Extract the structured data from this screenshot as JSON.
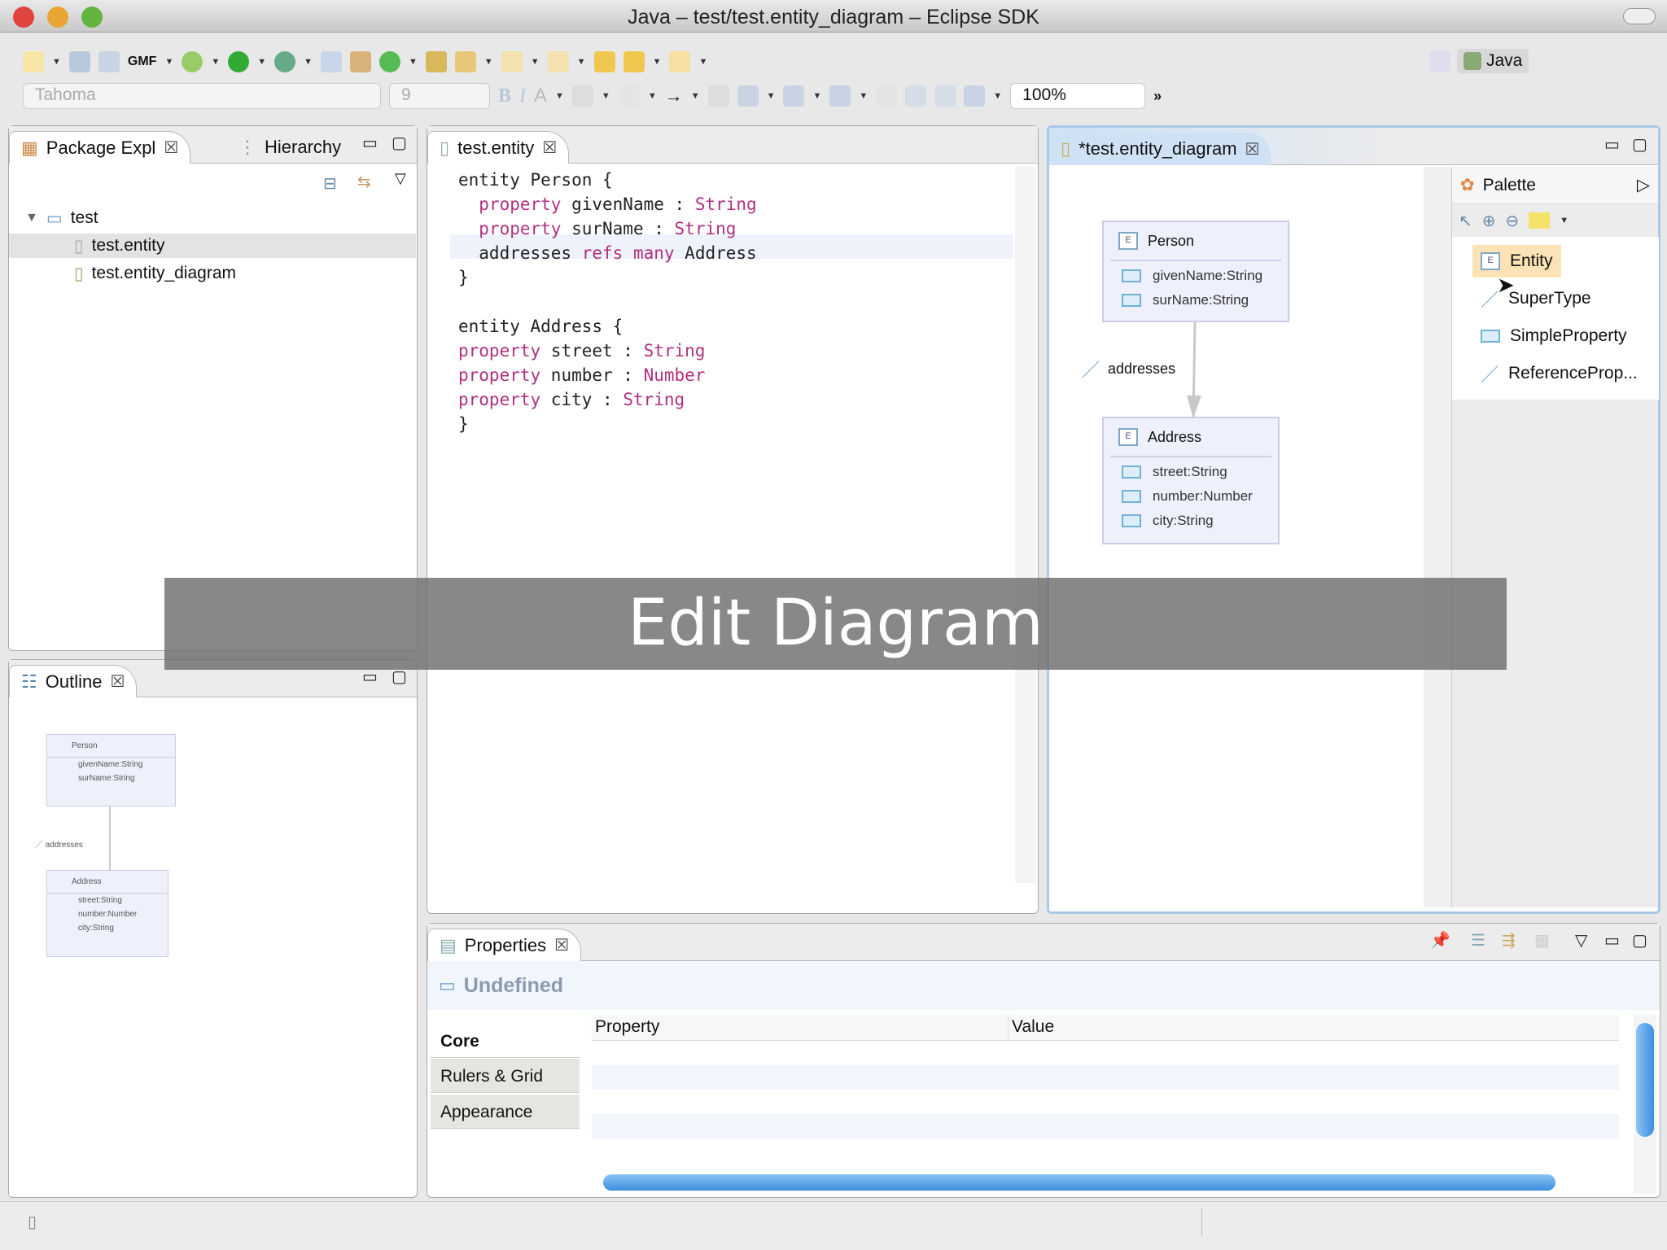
{
  "window": {
    "title": "Java – test/test.entity_diagram – Eclipse SDK"
  },
  "toolbar": {
    "gmf_label": "GMF",
    "font_name": "Tahoma",
    "font_size": "9",
    "zoom": "100%",
    "more": "»",
    "perspective": "Java"
  },
  "package_explorer": {
    "tab_label": "Package Expl",
    "hierarchy_tab": "Hierarchy",
    "tree": [
      {
        "label": "test"
      },
      {
        "label": "test.entity"
      },
      {
        "label": "test.entity_diagram"
      }
    ]
  },
  "outline": {
    "tab_label": "Outline"
  },
  "text_editor": {
    "tab_label": "test.entity",
    "lines": [
      [
        {
          "t": "entity Person {"
        }
      ],
      [
        {
          "t": "  "
        },
        {
          "t": "property",
          "k": 1
        },
        {
          "t": " givenName : "
        },
        {
          "t": "String",
          "k": 1
        }
      ],
      [
        {
          "t": "  "
        },
        {
          "t": "property",
          "k": 1
        },
        {
          "t": " surName : "
        },
        {
          "t": "String",
          "k": 1
        }
      ],
      [
        {
          "t": "  addresses "
        },
        {
          "t": "refs",
          "k": 1
        },
        {
          "t": " "
        },
        {
          "t": "many",
          "k": 1
        },
        {
          "t": " Address"
        }
      ],
      [
        {
          "t": "}"
        }
      ],
      [
        {
          "t": ""
        }
      ],
      [
        {
          "t": "entity Address {"
        }
      ],
      [
        {
          "t": "property",
          "k": 1
        },
        {
          "t": " street : "
        },
        {
          "t": "String",
          "k": 1
        }
      ],
      [
        {
          "t": "property",
          "k": 1
        },
        {
          "t": " number : "
        },
        {
          "t": "Number",
          "k": 1
        }
      ],
      [
        {
          "t": "property",
          "k": 1
        },
        {
          "t": " city : "
        },
        {
          "t": "String",
          "k": 1
        }
      ],
      [
        {
          "t": "}"
        }
      ]
    ]
  },
  "diagram_editor": {
    "tab_label": "*test.entity_diagram",
    "entities": [
      {
        "name": "Person",
        "icon_text": "E",
        "properties": [
          "givenName:String",
          "surName:String"
        ]
      },
      {
        "name": "Address",
        "icon_text": "E",
        "properties": [
          "street:String",
          "number:Number",
          "city:String"
        ]
      }
    ],
    "reference_label": "addresses"
  },
  "palette": {
    "title": "Palette",
    "items": [
      "Entity",
      "SuperType",
      "SimpleProperty",
      "ReferenceProp..."
    ]
  },
  "properties": {
    "tab_label": "Properties",
    "heading": "Undefined",
    "tabs": [
      "Core",
      "Rulers & Grid",
      "Appearance"
    ],
    "columns": [
      "Property",
      "Value"
    ]
  },
  "overlay": {
    "caption": "Edit Diagram"
  }
}
